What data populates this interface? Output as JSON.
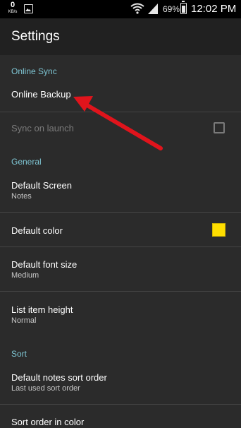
{
  "status_bar": {
    "speed_value": "0",
    "speed_unit": "KB/s",
    "battery_percent": "69%",
    "time": "12:02 PM",
    "icons": [
      "image-icon",
      "wifi-icon",
      "signal-icon",
      "battery-icon"
    ]
  },
  "app_bar": {
    "title": "Settings"
  },
  "sections": {
    "online_sync": {
      "header": "Online Sync",
      "online_backup": {
        "title": "Online Backup"
      },
      "sync_on_launch": {
        "title": "Sync on launch",
        "checked": false,
        "enabled": false
      }
    },
    "general": {
      "header": "General",
      "default_screen": {
        "title": "Default Screen",
        "summary": "Notes"
      },
      "default_color": {
        "title": "Default color",
        "swatch_color": "#ffde00"
      },
      "default_font_size": {
        "title": "Default font size",
        "summary": "Medium"
      },
      "list_item_height": {
        "title": "List item height",
        "summary": "Normal"
      }
    },
    "sort": {
      "header": "Sort",
      "default_notes_sort_order": {
        "title": "Default notes sort order",
        "summary": "Last used sort order"
      },
      "sort_order_in_color": {
        "title": "Sort order in color"
      }
    }
  },
  "annotation": {
    "arrow_color": "#e0141c"
  }
}
